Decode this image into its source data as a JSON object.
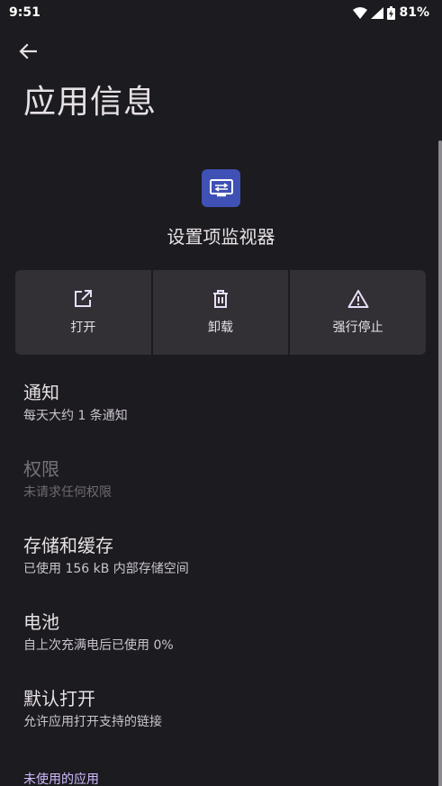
{
  "status_bar": {
    "time": "9:51",
    "battery_percent": "81%",
    "icons": [
      "wifi-icon",
      "signal-icon",
      "battery-icon"
    ]
  },
  "header": {
    "back_icon": "arrow-back-icon",
    "title": "应用信息"
  },
  "app": {
    "icon": "settings-monitor-app-icon",
    "icon_color": "#3f51b5",
    "name": "设置项监视器"
  },
  "actions": [
    {
      "label": "打开",
      "icon": "open-external-icon"
    },
    {
      "label": "卸载",
      "icon": "trash-icon"
    },
    {
      "label": "强行停止",
      "icon": "warning-icon"
    }
  ],
  "items": [
    {
      "title": "通知",
      "subtitle": "每天大约 1 条通知",
      "enabled": true
    },
    {
      "title": "权限",
      "subtitle": "未请求任何权限",
      "enabled": false
    },
    {
      "title": "存储和缓存",
      "subtitle": "已使用 156 kB 内部存储空间",
      "enabled": true
    },
    {
      "title": "电池",
      "subtitle": "自上次充满电后已使用 0%",
      "enabled": true
    },
    {
      "title": "默认打开",
      "subtitle": "允许应用打开支持的链接",
      "enabled": true
    }
  ],
  "section": {
    "unused_apps": "未使用的应用"
  },
  "colors": {
    "background": "#1c1b1f",
    "surface": "#322f35",
    "accent": "#d0bcff",
    "action_icon": "#e8def8"
  }
}
